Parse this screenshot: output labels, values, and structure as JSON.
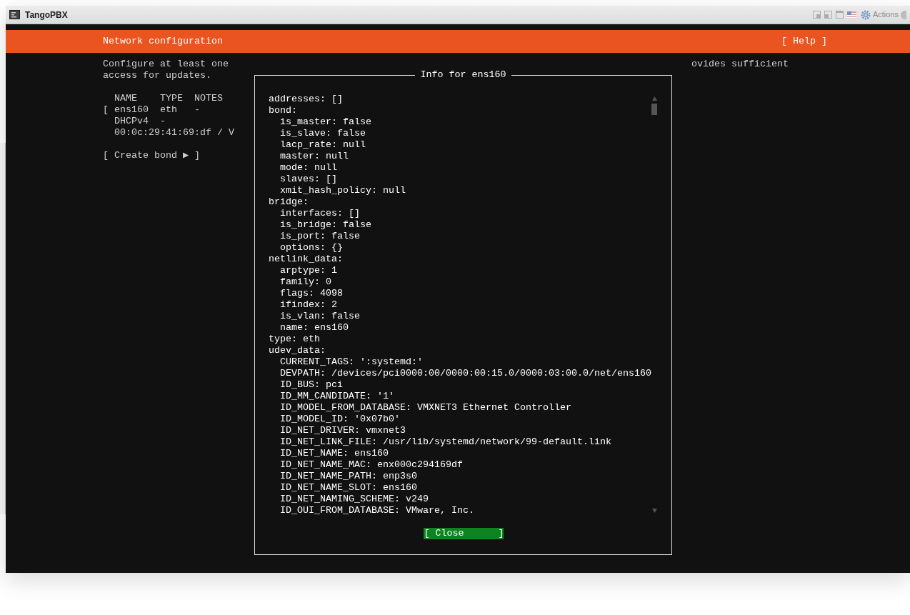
{
  "window": {
    "title": "TangoPBX",
    "actions_label": "Actions"
  },
  "header": {
    "title": "Network configuration",
    "help": "[ Help ]"
  },
  "intro": {
    "lines": [
      "Configure at least one",
      "access for updates."
    ],
    "right_fragment": "ovides sufficient"
  },
  "interfaces": {
    "columns": [
      "NAME",
      "TYPE",
      "NOTES"
    ],
    "rows": [
      {
        "bracket": "[",
        "name": "ens160",
        "type": "eth",
        "notes": "-",
        "details": [
          [
            "DHCPv4",
            "-"
          ],
          [
            "00:0c:29:41:69:df / V"
          ]
        ]
      }
    ],
    "create_bond": "[ Create bond ▶ ]"
  },
  "dialog": {
    "title": "Info for ens160",
    "close": "[ Close      ]",
    "entries": [
      {
        "text": "addresses: []"
      },
      {
        "text": "bond:",
        "children": [
          {
            "text": "is_master: false"
          },
          {
            "text": "is_slave: false"
          },
          {
            "text": "lacp_rate: null"
          },
          {
            "text": "master: null"
          },
          {
            "text": "mode: null"
          },
          {
            "text": "slaves: []"
          },
          {
            "text": "xmit_hash_policy: null"
          }
        ]
      },
      {
        "text": "bridge:",
        "children": [
          {
            "text": "interfaces: []"
          },
          {
            "text": "is_bridge: false"
          },
          {
            "text": "is_port: false"
          },
          {
            "text": "options: {}"
          }
        ]
      },
      {
        "text": "netlink_data:",
        "children": [
          {
            "text": "arptype: 1"
          },
          {
            "text": "family: 0"
          },
          {
            "text": "flags: 4098"
          },
          {
            "text": "ifindex: 2"
          },
          {
            "text": "is_vlan: false"
          },
          {
            "text": "name: ens160"
          }
        ]
      },
      {
        "text": "type: eth"
      },
      {
        "text": "udev_data:",
        "children": [
          {
            "text": "CURRENT_TAGS: ':systemd:'"
          },
          {
            "text": "DEVPATH: /devices/pci0000:00/0000:00:15.0/0000:03:00.0/net/ens160"
          },
          {
            "text": "ID_BUS: pci"
          },
          {
            "text": "ID_MM_CANDIDATE: '1'"
          },
          {
            "text": "ID_MODEL_FROM_DATABASE: VMXNET3 Ethernet Controller"
          },
          {
            "text": "ID_MODEL_ID: '0x07b0'"
          },
          {
            "text": "ID_NET_DRIVER: vmxnet3"
          },
          {
            "text": "ID_NET_LINK_FILE: /usr/lib/systemd/network/99-default.link"
          },
          {
            "text": "ID_NET_NAME: ens160"
          },
          {
            "text": "ID_NET_NAME_MAC: enx000c294169df"
          },
          {
            "text": "ID_NET_NAME_PATH: enp3s0"
          },
          {
            "text": "ID_NET_NAME_SLOT: ens160"
          },
          {
            "text": "ID_NET_NAMING_SCHEME: v249"
          },
          {
            "text": "ID_OUI_FROM_DATABASE: VMware, Inc."
          }
        ]
      }
    ]
  }
}
